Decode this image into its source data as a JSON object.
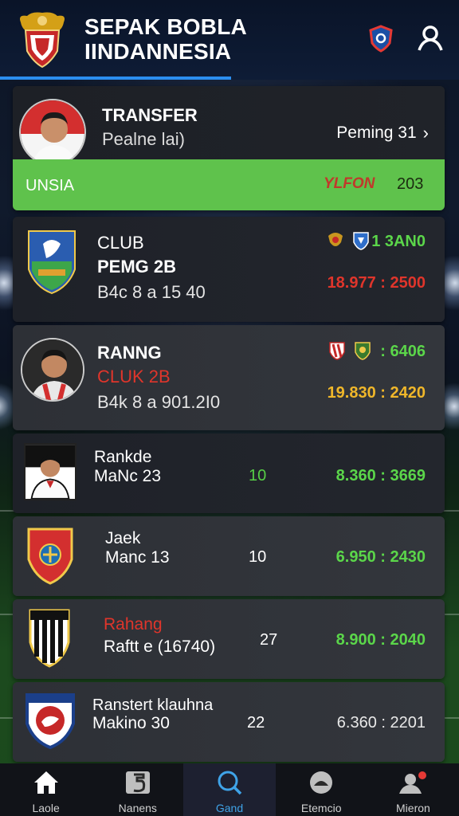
{
  "header": {
    "title_line1": "SEPAK BOBLA",
    "title_line2": "IINDANNESIA",
    "logo_icon": "garuda-crest-icon",
    "notification_icon": "shield-alert-icon",
    "profile_icon": "user-icon",
    "accent": "#2b8ef0"
  },
  "hero": {
    "title": "TRANSFER",
    "subtitle": "Pealne lai)",
    "link": "Peming 31",
    "chevron": "›",
    "bar_label": "UNSIA",
    "bar_tag": "YLFON",
    "bar_number": "203",
    "bar_color": "#5fc24c"
  },
  "rows": [
    {
      "line1": "CLUB",
      "line2": "PEMG 2B",
      "line3": "B4c 8 a 15 40",
      "stat_top": "1 3AN0",
      "stat_bottom": "18.977 : 2500"
    },
    {
      "line1": "RANNG",
      "line2": "CLUK 2B",
      "line3": "B4k 8 a 901.2I0",
      "stat_top": ": 6406",
      "stat_bottom": "19.830 : 2420"
    },
    {
      "line1": "Rankde",
      "line2": "MaNc 23",
      "mid": "10",
      "stat": "8.360 : 3669"
    },
    {
      "line1": "Jaek",
      "line2": "Manc 13",
      "mid": "10",
      "stat": "6.950 : 2430"
    },
    {
      "line1": "Rahang",
      "line2": "Raftt e (16740)",
      "mid": "27",
      "stat": "8.900 : 2040"
    },
    {
      "line1": "Ranstert klauhna",
      "line2": "Makino 30",
      "mid": "22",
      "stat": "6.360 : 2201"
    }
  ],
  "nav": [
    {
      "label": "Laole",
      "icon": "home-icon",
      "active": false
    },
    {
      "label": "Nanens",
      "icon": "scoreboard-icon",
      "active": false
    },
    {
      "label": "Gand",
      "icon": "search-icon",
      "active": true
    },
    {
      "label": "Etemcio",
      "icon": "stadium-icon",
      "active": false
    },
    {
      "label": "Mieron",
      "icon": "profile-notification-icon",
      "active": false
    }
  ]
}
